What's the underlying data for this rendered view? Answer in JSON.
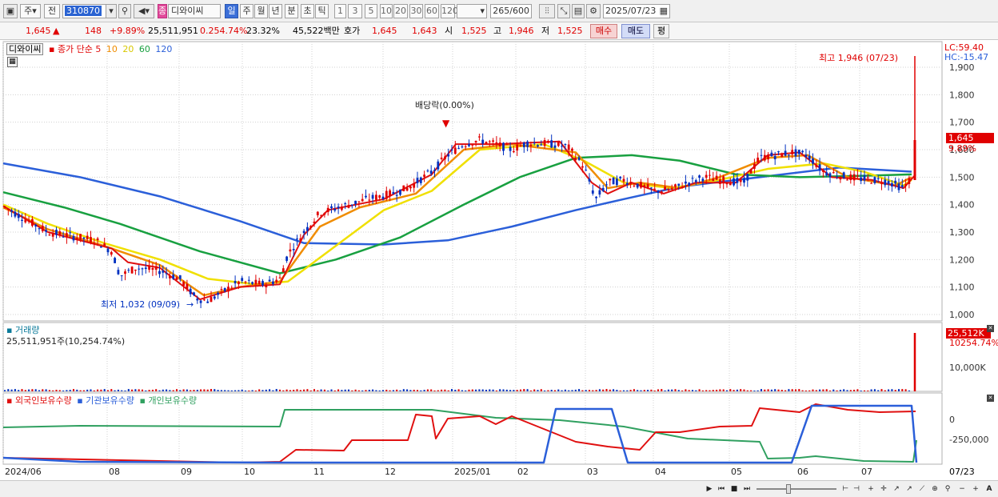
{
  "toolbar": {
    "market": "주",
    "prev": "전",
    "code": "310870",
    "pink_tag": "종",
    "name": "디와이씨",
    "periods": [
      "일",
      "주",
      "월",
      "년",
      "분",
      "초",
      "틱"
    ],
    "period_selected": "일",
    "intervals": [
      "1",
      "3",
      "5",
      "10",
      "20",
      "30",
      "60",
      "120"
    ],
    "count": "265",
    "count_total": "/600",
    "date": "2025/07/23"
  },
  "quote": {
    "price": "1,645",
    "change": "148",
    "change_pct": "+9.89%",
    "volume": "25,511,951",
    "volume_pct": "0.254.74%",
    "turnover": "23.32%",
    "amount": "45,522백만",
    "bid_label": "호가",
    "ask": "1,645",
    "bid": "1,643",
    "open_label": "시",
    "open": "1,525",
    "high_label": "고",
    "high": "1,946",
    "low_label": "저",
    "low": "1,525",
    "buy": "매수",
    "sell": "매도",
    "avg": "평"
  },
  "price_panel": {
    "stock_tag": "디와이씨",
    "legend_prefix": "종가 단순",
    "ma_periods": [
      "5",
      "10",
      "20",
      "60",
      "120"
    ],
    "lc": "LC:59.40",
    "hc": "HC:-15.47",
    "high_note": "최고 1,946 (07/23)",
    "low_note": "최저 1,032 (09/09)",
    "dividend_note": "배당락(0.00%)",
    "last_price_tag": "1,645",
    "last_pct_tag": "9.89%",
    "y_ticks": [
      "1,900",
      "1,800",
      "1,700",
      "1,600",
      "1,500",
      "1,400",
      "1,300",
      "1,200",
      "1,100",
      "1,000"
    ]
  },
  "volume_panel": {
    "title": "거래량",
    "value": "25,511,951주(10,254.74%)",
    "tag_value": "25,512K",
    "tag_pct": "10254.74%",
    "y_tick": "10,000K"
  },
  "holding_panel": {
    "legend": [
      "외국인보유수량",
      "기관보유수량",
      "개인보유수량"
    ],
    "y_ticks": [
      "0",
      "-250,000"
    ]
  },
  "x_axis": {
    "labels": [
      "2024/06",
      "08",
      "09",
      "10",
      "11",
      "12",
      "2025/01",
      "02",
      "03",
      "04",
      "05",
      "06",
      "07"
    ],
    "right_label": "07/23"
  },
  "colors": {
    "ma5": "#e01010",
    "ma10": "#f08c00",
    "ma20": "#f0e000",
    "ma60": "#18a040",
    "ma120": "#2b5fd9",
    "up": "#e00000",
    "down": "#0030c0",
    "foreign": "#e01010",
    "institution": "#2b5fd9",
    "individual": "#30a060"
  }
}
